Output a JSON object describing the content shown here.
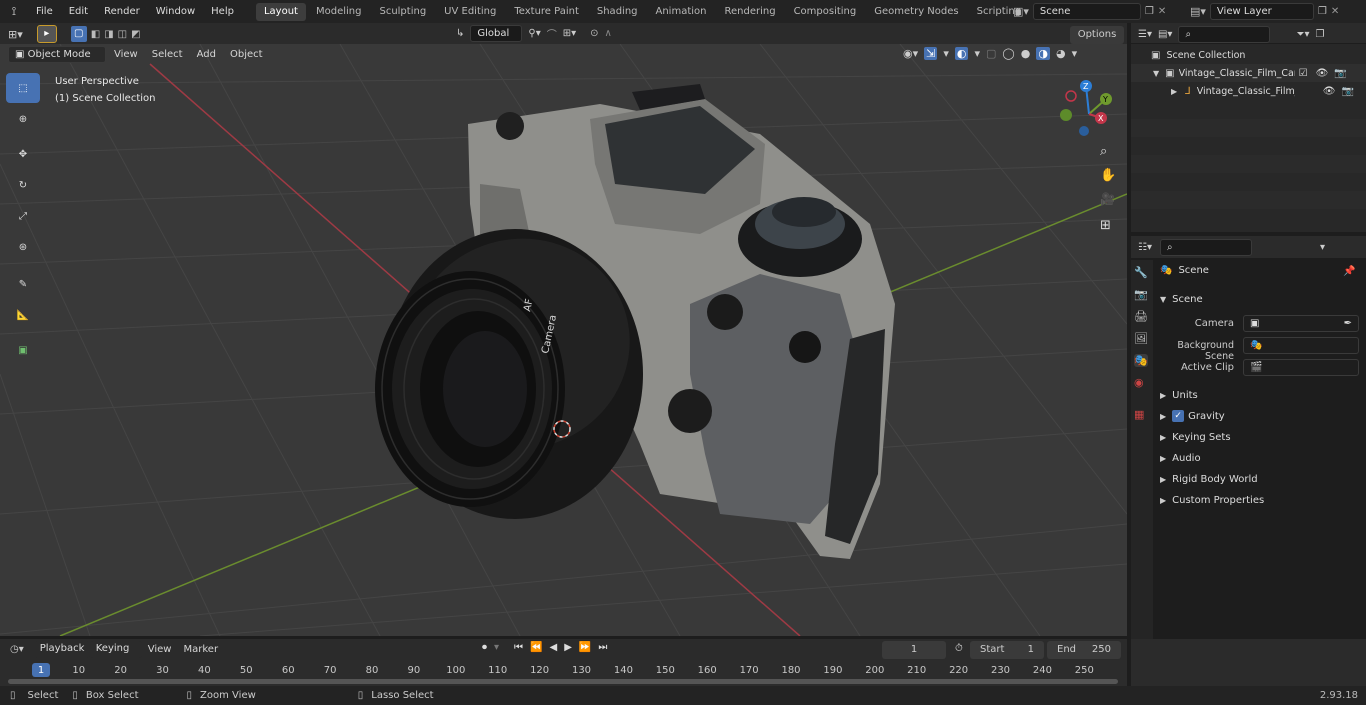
{
  "menu": {
    "items": [
      "File",
      "Edit",
      "Render",
      "Window",
      "Help"
    ]
  },
  "workspaces": [
    "Layout",
    "Modeling",
    "Sculpting",
    "UV Editing",
    "Texture Paint",
    "Shading",
    "Animation",
    "Rendering",
    "Compositing",
    "Geometry Nodes",
    "Scripting"
  ],
  "active_workspace": "Layout",
  "scene_field": "Scene",
  "view_layer_field": "View Layer",
  "viewport_header": {
    "mode": "Object Mode",
    "menus": [
      "View",
      "Select",
      "Add",
      "Object"
    ],
    "orientation": "Global",
    "options": "Options"
  },
  "viewport_overlay": {
    "perspective": "User Perspective",
    "collection": "(1) Scene Collection"
  },
  "gizmo": {
    "x": "X",
    "y": "Y",
    "z": "Z"
  },
  "outliner": {
    "root": "Scene Collection",
    "items": [
      "Vintage_Classic_Film_Camera",
      "Vintage_Classic_Film_Ca"
    ]
  },
  "properties": {
    "breadcrumb": "Scene",
    "panel": "Scene",
    "camera_label": "Camera",
    "background_label": "Background Scene",
    "clip_label": "Active Clip",
    "sections": [
      "Units",
      "Gravity",
      "Keying Sets",
      "Audio",
      "Rigid Body World",
      "Custom Properties"
    ],
    "gravity_checked": true
  },
  "timeline_header": {
    "menus": [
      "Playback",
      "Keying",
      "View",
      "Marker"
    ],
    "current_frame": "1",
    "start_label": "Start",
    "start_value": "1",
    "end_label": "End",
    "end_value": "250"
  },
  "timeline_ticks": [
    "1",
    "10",
    "20",
    "30",
    "40",
    "50",
    "60",
    "70",
    "80",
    "90",
    "100",
    "110",
    "120",
    "130",
    "140",
    "150",
    "160",
    "170",
    "180",
    "190",
    "200",
    "210",
    "220",
    "230",
    "240",
    "250"
  ],
  "statusbar": {
    "select": "Select",
    "box_select": "Box Select",
    "zoom_view": "Zoom View",
    "lasso_select": "Lasso Select",
    "version": "2.93.18"
  },
  "lens_text": {
    "brand": "Camera",
    "af": "AF"
  },
  "colors": {
    "accent": "#4772b3",
    "x_axis": "#c3364a",
    "y_axis": "#6f9a2d",
    "z_axis": "#2c7ed6"
  }
}
